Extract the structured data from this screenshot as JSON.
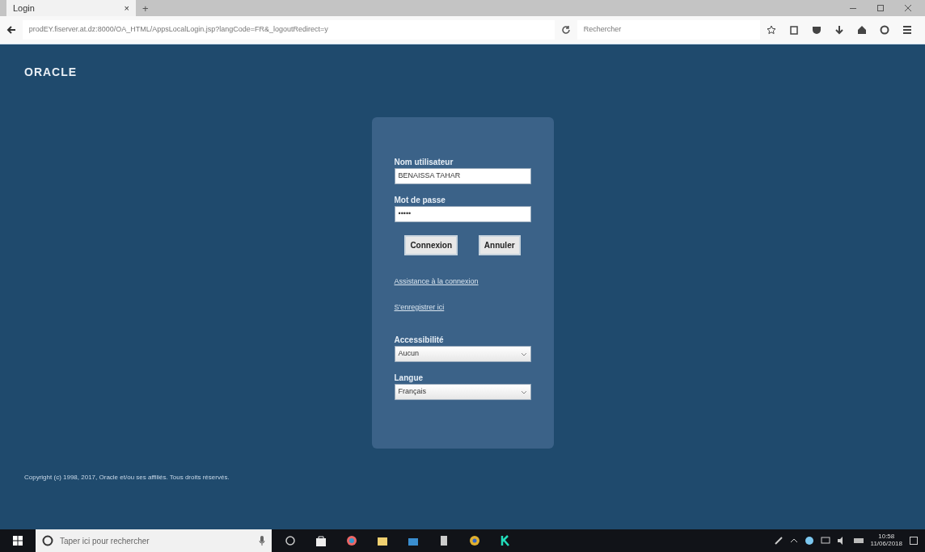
{
  "browser": {
    "tab_title": "Login",
    "tab_close": "×",
    "new_tab": "+",
    "url": "prodEY.fiserver.at.dz:8000/OA_HTML/AppsLocalLogin.jsp?langCode=FR&_logoutRedirect=y",
    "search_placeholder": "Rechercher"
  },
  "page": {
    "logo": "ORACLE",
    "login": {
      "username_label": "Nom utilisateur",
      "username_value": "BENAISSA TAHAR",
      "password_label": "Mot de passe",
      "password_value": "•••••",
      "buttons": [
        "Connexion",
        "Annuler"
      ],
      "links": [
        "Assistance à la connexion",
        "S'enregistrer ici"
      ],
      "selects": [
        {
          "label": "Accessibilité",
          "value": "Aucun"
        },
        {
          "label": "Langue",
          "value": "Français"
        }
      ]
    },
    "copyright": "Copyright (c) 1998, 2017, Oracle et/ou ses affiliés. Tous droits réservés."
  },
  "taskbar": {
    "search_placeholder": "Taper ici pour rechercher",
    "time": "10:58",
    "date": "11/06/2018"
  }
}
